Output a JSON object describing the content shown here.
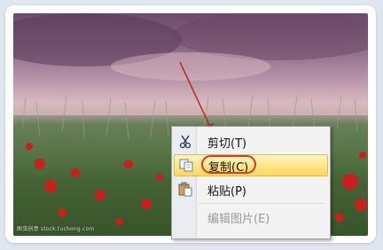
{
  "context_menu": {
    "items": [
      {
        "label": "剪切(T)",
        "icon": "scissors-icon",
        "state": "normal"
      },
      {
        "label": "复制(C)",
        "icon": "copy-icon",
        "state": "highlighted"
      },
      {
        "label": "粘贴(P)",
        "icon": "paste-icon",
        "state": "normal"
      },
      {
        "label": "编辑图片(E)",
        "icon": "",
        "state": "disabled"
      }
    ]
  },
  "photo": {
    "watermark": "图虫创意 stock.tuchong.com"
  },
  "colors": {
    "highlight": "#ffe48a",
    "annotation": "#d23b2e"
  }
}
